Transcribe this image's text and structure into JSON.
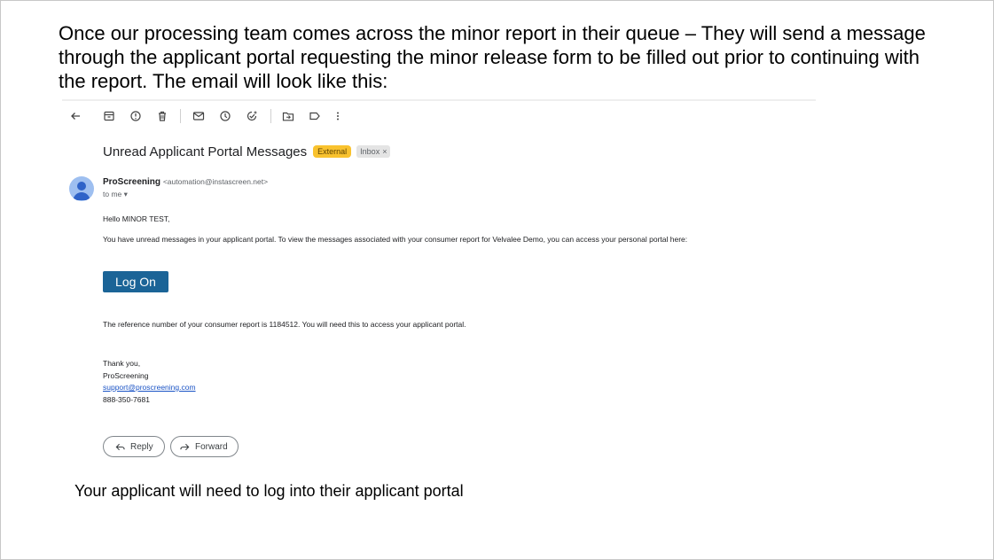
{
  "intro_text": "Once our processing team comes across the minor report in their queue – They will send a message through the applicant portal requesting the minor release form to be filled out prior to continuing with the report. The email will look like this:",
  "email": {
    "toolbar_icons": [
      "back-arrow-icon",
      "archive-icon",
      "report-spam-icon",
      "delete-icon",
      "mark-unread-icon",
      "snooze-icon",
      "add-task-icon",
      "move-to-icon",
      "label-icon",
      "more-options-icon"
    ],
    "subject": "Unread Applicant Portal Messages",
    "badge_external": "External",
    "badge_inbox": "Inbox",
    "badge_inbox_close": "×",
    "sender_name": "ProScreening",
    "sender_email": "<automation@instascreen.net>",
    "to_me": "to me",
    "greeting": "Hello MINOR TEST,",
    "message": "You have unread messages in your applicant portal. To view the messages associated with your consumer report for Velvalee Demo, you can access your personal portal here:",
    "logon_label": "Log On",
    "reference_text": "The reference number of your consumer report is 1184512. You will need this to access your applicant portal.",
    "signature": {
      "thanks": "Thank you,",
      "company": "ProScreening",
      "email": "support@proscreening.com",
      "phone": "888-350-7681"
    },
    "reply_label": "Reply",
    "forward_label": "Forward"
  },
  "bottom_note": "Your applicant will need to log into their applicant portal",
  "colors": {
    "logon_button": "#1b6497",
    "external_badge": "#f9c22e",
    "link": "#1a53c5"
  }
}
